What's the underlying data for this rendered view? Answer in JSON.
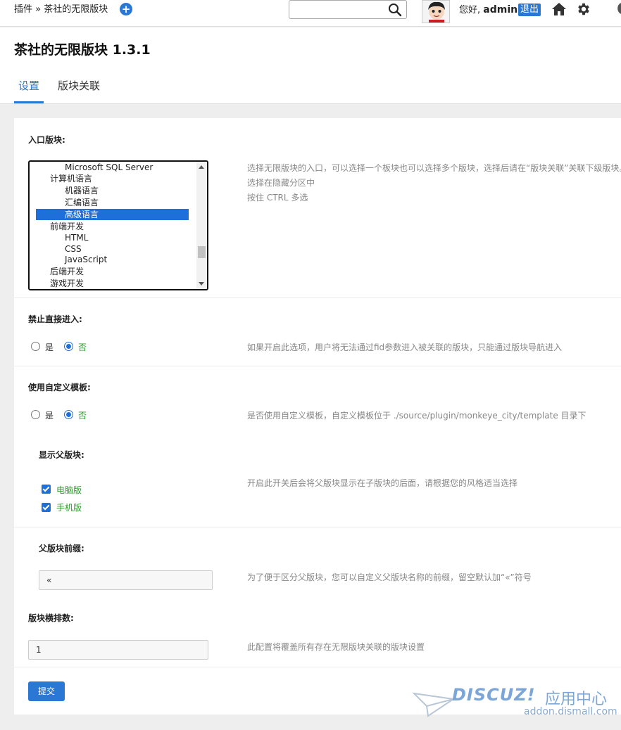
{
  "topbar": {
    "breadcrumb": "插件 » 茶社的无限版块",
    "add_icon": "plus-circle-icon",
    "search_placeholder": "",
    "greeting_prefix": "您好, ",
    "username": "admin",
    "logout": "退出",
    "icons": [
      "search-icon",
      "avatar",
      "home-icon",
      "gear-icon",
      "moon-icon"
    ]
  },
  "header": {
    "title": "茶社的无限版块 1.3.1",
    "tabs": [
      {
        "label": "设置",
        "active": true
      },
      {
        "label": "版块关联",
        "active": false
      }
    ]
  },
  "form": {
    "entry": {
      "label": "入口版块:",
      "options": [
        {
          "text": "Microsoft SQL Server",
          "level": 2,
          "selected": false
        },
        {
          "text": "计算机语言",
          "level": 1,
          "selected": false
        },
        {
          "text": "机器语言",
          "level": 2,
          "selected": false
        },
        {
          "text": "汇编语言",
          "level": 2,
          "selected": false
        },
        {
          "text": "高级语言",
          "level": 2,
          "selected": true
        },
        {
          "text": "前端开发",
          "level": 1,
          "selected": false
        },
        {
          "text": "HTML",
          "level": 2,
          "selected": false
        },
        {
          "text": "CSS",
          "level": 2,
          "selected": false
        },
        {
          "text": "JavaScript",
          "level": 2,
          "selected": false
        },
        {
          "text": "后端开发",
          "level": 1,
          "selected": false
        },
        {
          "text": "游戏开发",
          "level": 1,
          "selected": false
        }
      ],
      "hints": [
        "选择无限版块的入口，可以选择一个板块也可以选择多个版块，选择后请在“版块关联”关联下级版块。",
        "选择在隐藏分区中",
        "按住 CTRL 多选"
      ]
    },
    "no_direct": {
      "label": "禁止直接进入:",
      "yes": "是",
      "no": "否",
      "value": "no",
      "hint": "如果开启此选项，用户将无法通过fid参数进入被关联的版块，只能通过版块导航进入"
    },
    "custom_tpl": {
      "label": "使用自定义模板:",
      "yes": "是",
      "no": "否",
      "value": "no",
      "hint": "是否使用自定义模板，自定义模板位于 ./source/plugin/monkeye_city/template 目录下"
    },
    "show_parent": {
      "label": "显示父版块:",
      "desktop": "电脑版",
      "mobile": "手机版",
      "desktop_checked": true,
      "mobile_checked": true,
      "hint": "开启此开关后会将父版块显示在子版块的后面，请根据您的风格适当选择"
    },
    "parent_prefix": {
      "label": "父版块前缀:",
      "value": "«",
      "hint": "为了便于区分父版块，您可以自定义父版块名称的前缀，留空默认加“«”符号"
    },
    "per_row": {
      "label": "版块横排数:",
      "value": "1",
      "hint": "此配置将覆盖所有存在无限版块关联的版块设置"
    },
    "submit": "提交"
  },
  "watermark": {
    "brand": "DISCUZ!",
    "cn": "应用中心",
    "url": "addon.dismall.com"
  },
  "colors": {
    "accent": "#2b78d4",
    "selected": "#1e6fd9",
    "green": "#2a9d2a",
    "hint": "#888888"
  }
}
